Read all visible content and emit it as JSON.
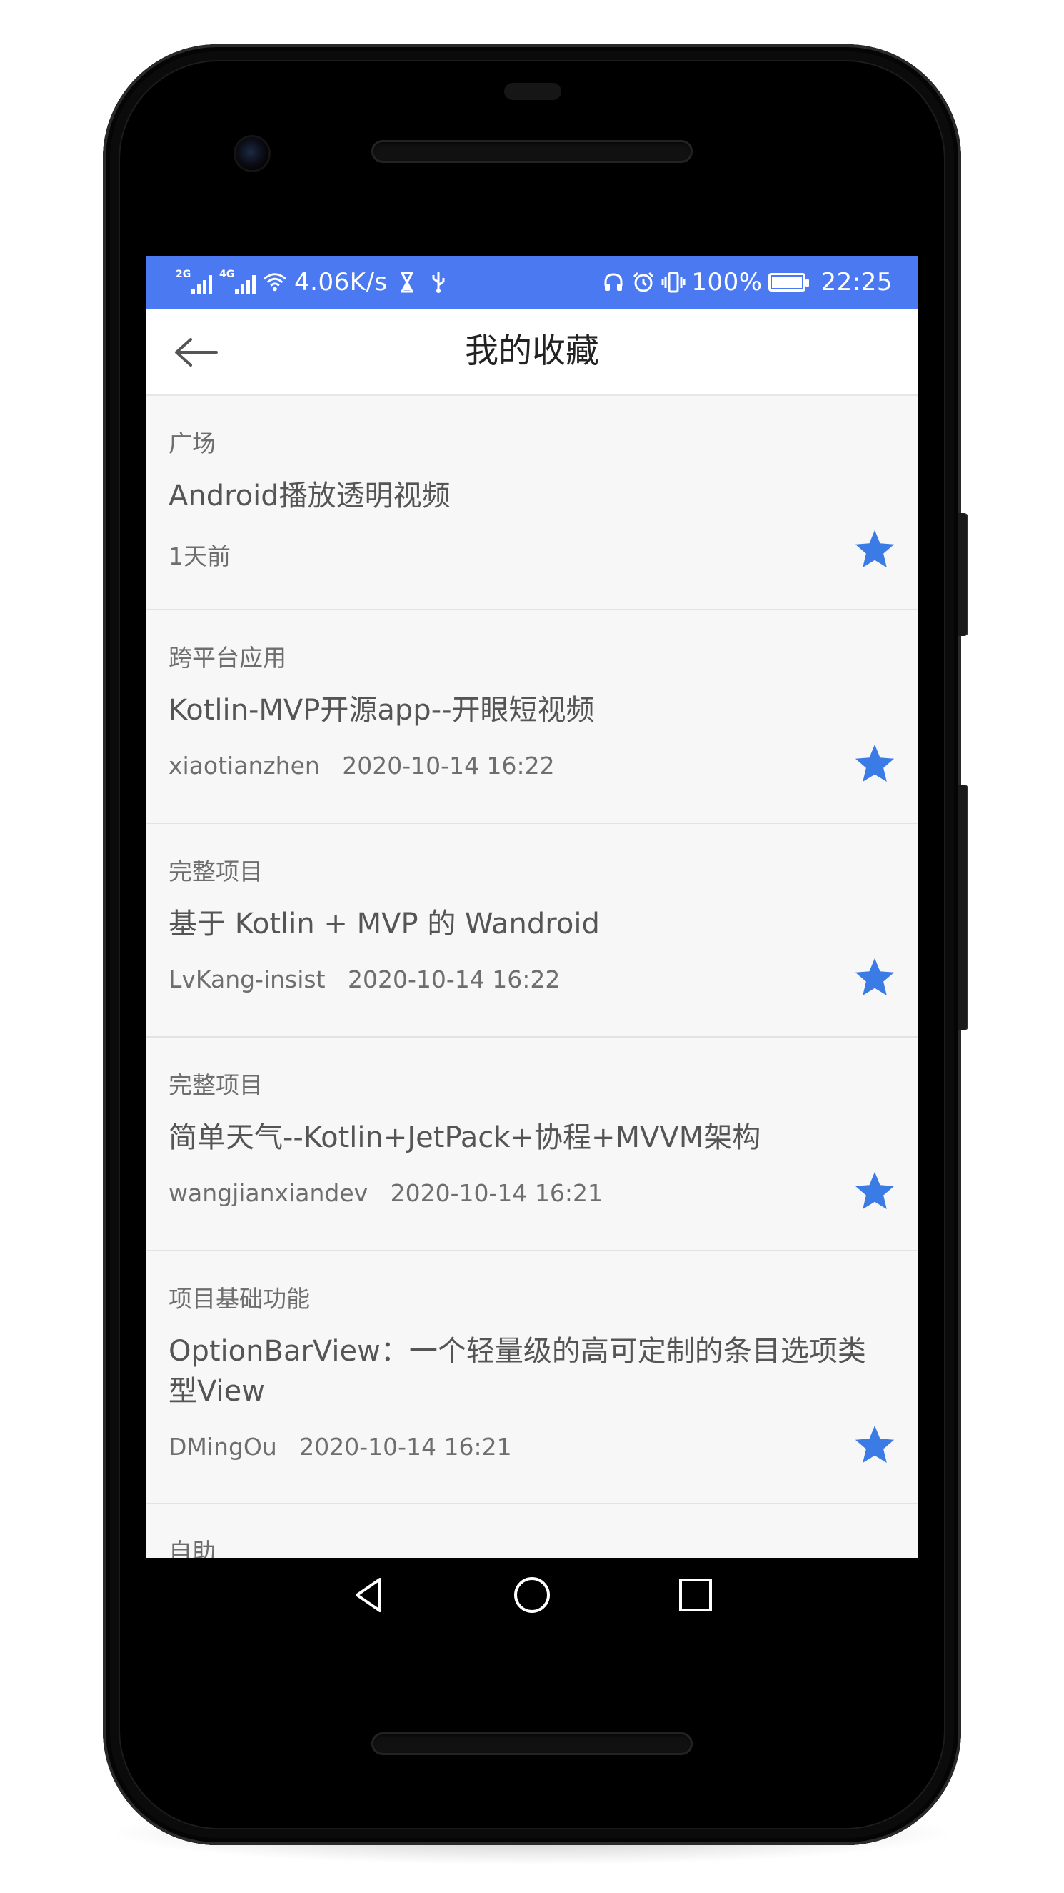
{
  "status_bar": {
    "sim1_tag": "2G",
    "sim2_tag": "4G",
    "speed": "4.06K/s",
    "battery_percent": "100%",
    "time": "22:25",
    "background_color": "#4a79f2"
  },
  "app_bar": {
    "title": "我的收藏",
    "back_icon": "arrow-left-icon"
  },
  "favorites": [
    {
      "chapter": "广场",
      "title": "Android播放透明视频",
      "meta": "1天前",
      "starred": true
    },
    {
      "chapter": "跨平台应用",
      "title": "Kotlin-MVP开源app--开眼短视频",
      "meta": "xiaotianzhen   2020-10-14 16:22",
      "starred": true
    },
    {
      "chapter": "完整项目",
      "title": "基于 Kotlin + MVP 的 Wandroid",
      "meta": "LvKang-insist   2020-10-14 16:22",
      "starred": true
    },
    {
      "chapter": "完整项目",
      "title": "简单天气--Kotlin+JetPack+协程+MVVM架构",
      "meta": "wangjianxiandev   2020-10-14 16:21",
      "starred": true
    },
    {
      "chapter": "项目基础功能",
      "title": "OptionBarView：一个轻量级的高可定制的条目选项类型View",
      "meta": "DMingOu   2020-10-14 16:21",
      "starred": true
    },
    {
      "chapter": "自助",
      "title": "",
      "meta": "",
      "starred": true
    }
  ],
  "star_color": "#3a7be6",
  "nav_bar": {
    "back_icon": "triangle-back-icon",
    "home_icon": "circle-home-icon",
    "recents_icon": "square-recents-icon"
  }
}
